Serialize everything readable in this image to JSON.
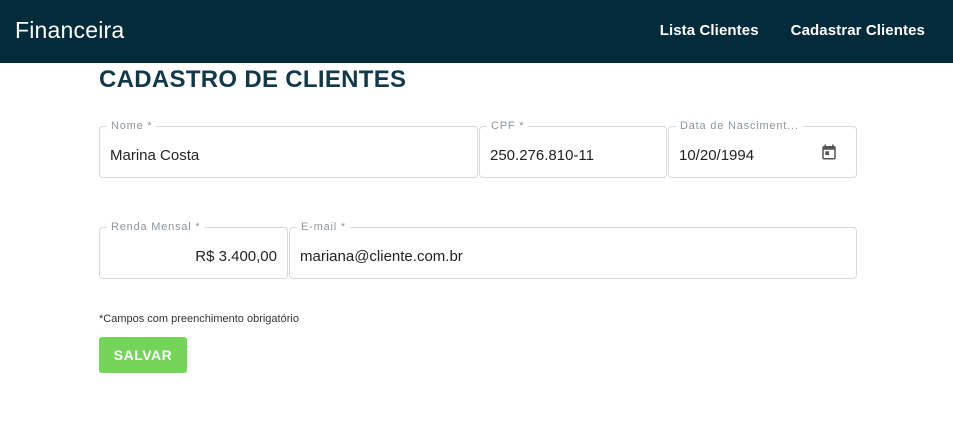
{
  "header": {
    "brand": "Financeira",
    "nav": [
      {
        "label": "Lista Clientes"
      },
      {
        "label": "Cadastrar Clientes"
      }
    ],
    "background": "#032b39"
  },
  "page": {
    "title": "CADASTRO DE CLIENTES"
  },
  "form": {
    "nome": {
      "label": "Nome *",
      "value": "Marina Costa"
    },
    "cpf": {
      "label": "CPF *",
      "value": "250.276.810-11"
    },
    "data_nascimento": {
      "label": "Data de Nasciment...",
      "value": "10/20/1994",
      "icon": "calendar-icon"
    },
    "renda_mensal": {
      "label": "Renda Mensal *",
      "value": "R$ 3.400,00"
    },
    "email": {
      "label": "E-mail *",
      "value": "mariana@cliente.com.br"
    },
    "note": "*Campos com preenchimento obrigatório",
    "save_label": "SALVAR",
    "save_color": "#74d45a"
  }
}
